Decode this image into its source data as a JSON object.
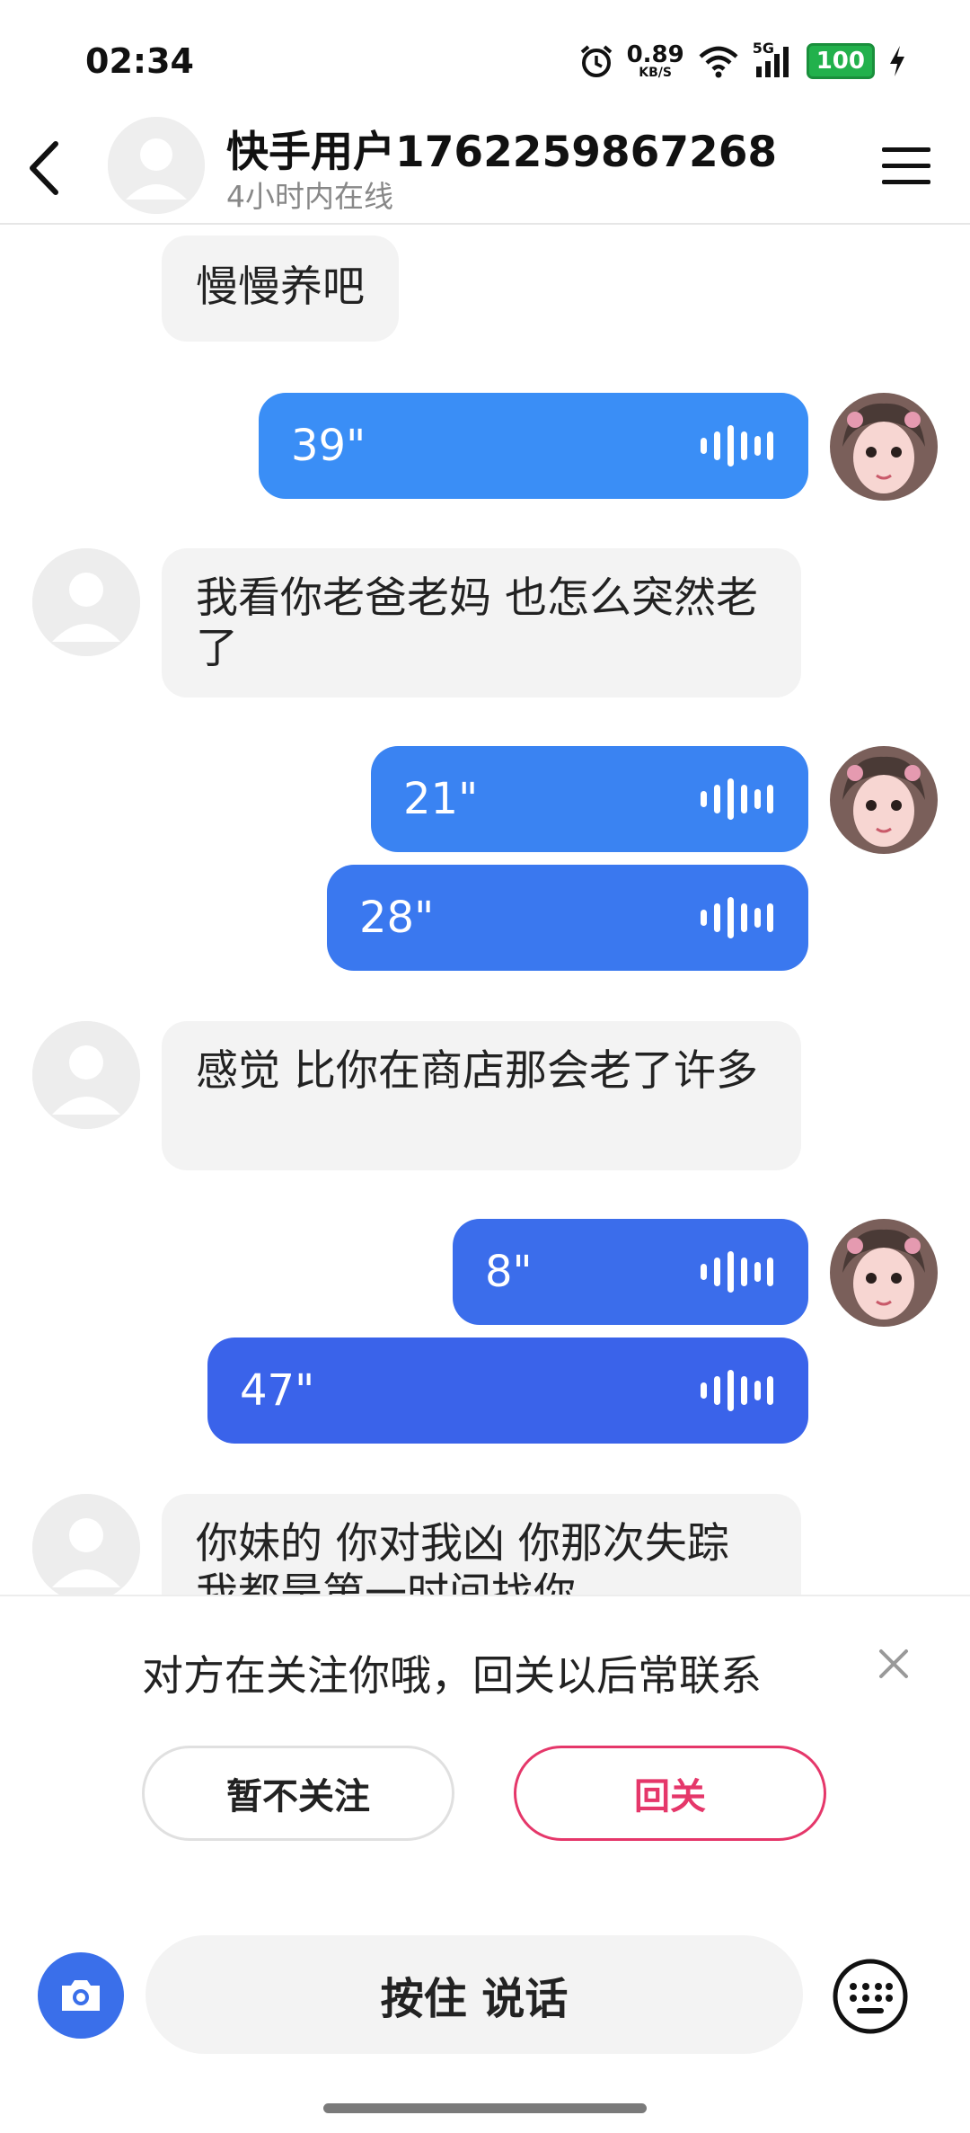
{
  "status_bar": {
    "time": "02:34",
    "net_speed": "0.89",
    "net_unit": "KB/S",
    "signal_label": "5G",
    "battery": "100"
  },
  "header": {
    "name": "快手用户1762259867268",
    "online_status": "4小时内在线"
  },
  "messages": [
    {
      "side": "in",
      "type": "text",
      "text": "慢慢养吧"
    },
    {
      "side": "out",
      "type": "voice",
      "duration": "39\""
    },
    {
      "side": "in",
      "type": "text",
      "text": "我看你老爸老妈  也怎么突然老了"
    },
    {
      "side": "out",
      "type": "voice",
      "duration": "21\""
    },
    {
      "side": "out",
      "type": "voice",
      "duration": "28\""
    },
    {
      "side": "in",
      "type": "text",
      "text": "感觉 比你在商店那会老了许多"
    },
    {
      "side": "out",
      "type": "voice",
      "duration": "8\""
    },
    {
      "side": "out",
      "type": "voice",
      "duration": "47\""
    },
    {
      "side": "in",
      "type": "text",
      "text": "你妹的 你对我凶 你那次失踪我都是第一时间找你"
    }
  ],
  "follow_prompt": {
    "text": "对方在关注你哦，回关以后常联系",
    "decline_label": "暂不关注",
    "follow_label": "回关"
  },
  "input_bar": {
    "hold_to_talk_label": "按住 说话"
  },
  "colors": {
    "voice_bubble_light": "#3a8ef6",
    "voice_bubble_dark": "#3a63ea",
    "follow_accent": "#e5376a",
    "camera_button": "#3a6fea"
  }
}
